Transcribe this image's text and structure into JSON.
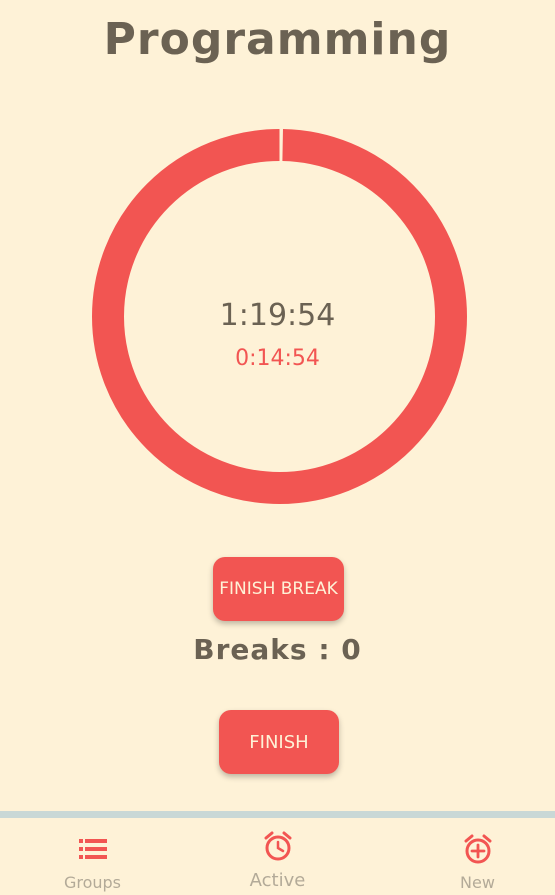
{
  "header": {
    "title": "Programming"
  },
  "timer": {
    "elapsed": "1:19:54",
    "break_time": "0:14:54",
    "progress_fraction": 0.997
  },
  "actions": {
    "finish_break_label": "FINISH BREAK",
    "breaks_text": "Breaks : 0",
    "finish_label": "FINISH"
  },
  "nav": {
    "items": [
      {
        "label": "Groups",
        "icon": "list-icon"
      },
      {
        "label": "Active",
        "icon": "alarm-clock-icon"
      },
      {
        "label": "New",
        "icon": "alarm-add-icon"
      }
    ]
  },
  "colors": {
    "background": "#fef2d7",
    "accent": "#f25552",
    "text": "#6b6253",
    "muted": "#b3aa98",
    "divider": "#c9d8d6"
  }
}
